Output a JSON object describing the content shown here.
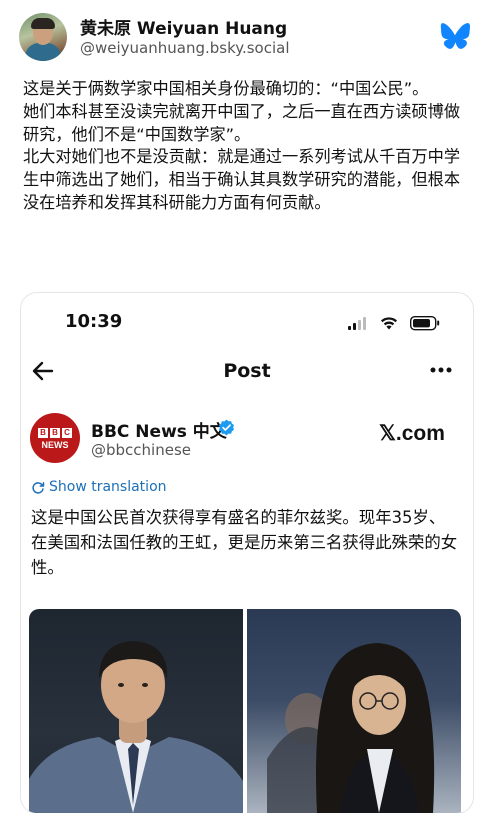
{
  "post": {
    "author_name": "黄未原 Weiyuan Huang",
    "author_handle": "@weiyuanhuang.bsky.social",
    "paragraphs": [
      "这是关于俩数学家中国相关身份最确切的：“中国公民”。",
      "她们本科甚至没读完就离开中国了，之后一直在西方读硕博做研究，他们不是“中国数学家”。",
      "北大对她们也不是没贡献：就是通过一系列考试从千百万中学生中筛选出了她们，相当于确认其具数学研究的潜能，但根本没在培养和发挥其科研能力方面有何贡献。"
    ]
  },
  "screenshot": {
    "time": "10:39",
    "nav_title": "Post",
    "account_name": "BBC News 中文",
    "account_handle": "@bbcchinese",
    "logo_letters": [
      "B",
      "B",
      "C"
    ],
    "logo_word": "NEWS",
    "site_mark": "𝕏.com",
    "show_translation": "Show translation",
    "tweet_text": "这是中国公民首次获得享有盛名的菲尔兹奖。现年35岁、在美国和法国任教的王虹，更是历来第三名获得此殊荣的女性。"
  },
  "icons": {
    "bsky": "butterfly-icon",
    "back": "back-arrow-icon",
    "more": "more-icon",
    "verified": "verified-badge-icon",
    "translate": "translate-icon"
  },
  "colors": {
    "bsky_blue": "#1185fe",
    "bbc_red": "#bb1919",
    "link_blue": "#1d6fb8",
    "verified_blue": "#1d9bf0"
  }
}
